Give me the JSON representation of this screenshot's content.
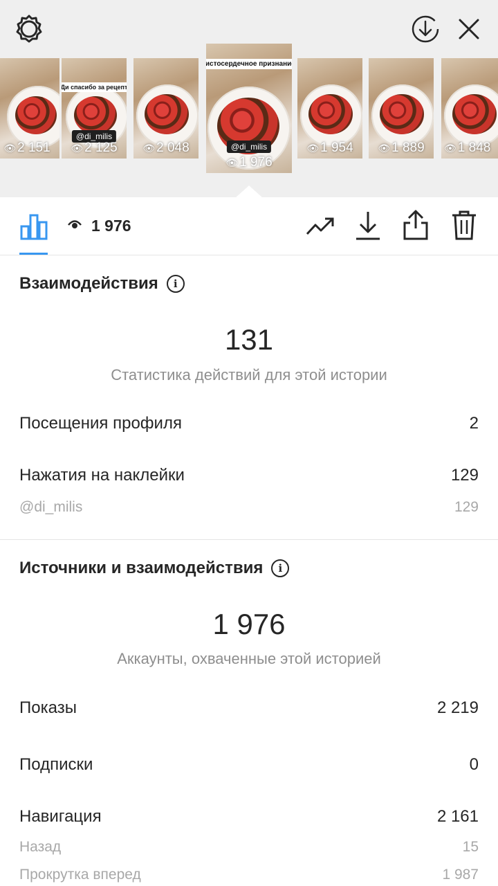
{
  "stories": [
    {
      "views": "2 151",
      "sticker": "",
      "caption": ""
    },
    {
      "views": "2 125",
      "sticker": "@di_milis",
      "caption": "Ди спасибо за рецепт"
    },
    {
      "views": "2 048",
      "sticker": "",
      "caption": ""
    },
    {
      "views": "1 976",
      "sticker": "@di_milis",
      "caption": "Мое чистосердечное признание тебе"
    },
    {
      "views": "1 954",
      "sticker": "",
      "caption": ""
    },
    {
      "views": "1 889",
      "sticker": "",
      "caption": ""
    },
    {
      "views": "1 848",
      "sticker": "",
      "caption": ""
    }
  ],
  "toolbar": {
    "views": "1 976"
  },
  "interactions": {
    "title": "Взаимодействия",
    "total": "131",
    "subtitle": "Статистика действий для этой истории",
    "rows": [
      {
        "label": "Посещения профиля",
        "value": "2"
      },
      {
        "label": "Нажатия на наклейки",
        "value": "129"
      }
    ],
    "sub_rows": [
      {
        "label": "@di_milis",
        "value": "129"
      }
    ]
  },
  "sources": {
    "title": "Источники и взаимодействия",
    "total": "1 976",
    "subtitle": "Аккаунты, охваченные этой историей",
    "rows": [
      {
        "label": "Показы",
        "value": "2 219"
      },
      {
        "label": "Подписки",
        "value": "0"
      },
      {
        "label": "Навигация",
        "value": "2 161"
      }
    ],
    "sub_rows": [
      {
        "label": "Назад",
        "value": "15"
      },
      {
        "label": "Прокрутка вперед",
        "value": "1 987"
      }
    ]
  },
  "colors": {
    "accent": "#3897f0",
    "text": "#262626",
    "muted": "#8e8e8e",
    "reel_bg": "#efefef"
  }
}
